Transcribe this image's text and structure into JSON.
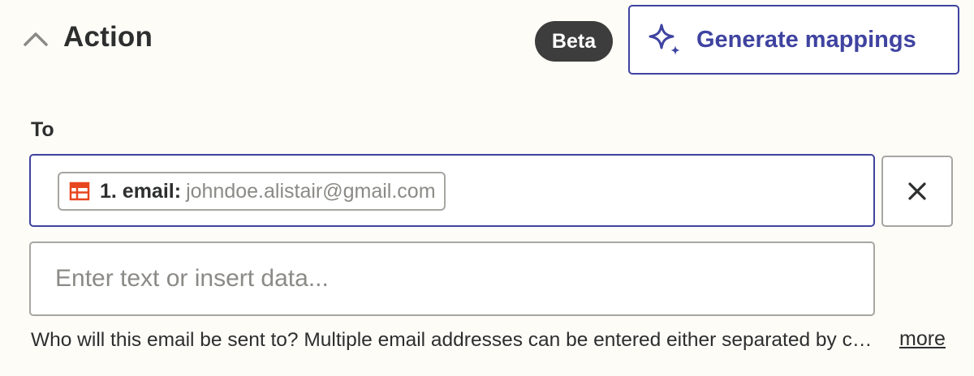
{
  "section": {
    "title": "Action",
    "badge": "Beta",
    "generate_button_label": "Generate mappings"
  },
  "field": {
    "label": "To",
    "mapped_value": {
      "icon": "table-icon",
      "key": "1. email:",
      "value": "johndoe.alistair@gmail.com"
    },
    "input_placeholder": "Enter text or insert data...",
    "help_text": "Who will this email be sent to? Multiple email addresses can be entered either separated by commas or as separate values.",
    "more_label": "more"
  },
  "icons": {
    "collapse": "chevron-up-icon",
    "generate": "sparkle-icon",
    "clear": "close-icon"
  },
  "colors": {
    "background": "#fdfcf7",
    "accent": "#3f43a0",
    "badge_bg": "#3d3d3d",
    "table_icon": "#e8461e"
  }
}
